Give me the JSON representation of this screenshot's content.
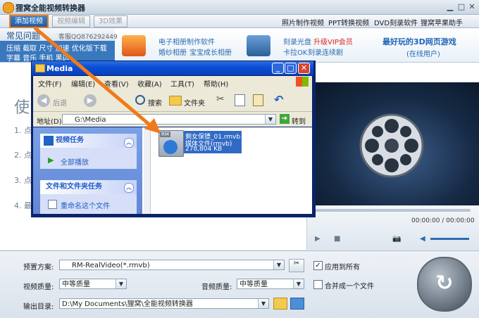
{
  "app": {
    "title": "狸窝全能视频转换器"
  },
  "toolbar": {
    "add_video": "添加视频",
    "video_edit": "视频编辑",
    "effect_3d": "3D效果",
    "links": [
      "照片制作视频",
      "PPT转换视频",
      "DVD刻录软件",
      "狸窝苹果助手"
    ]
  },
  "faq": {
    "title": "常见问题",
    "qq": "客服QQ876292449",
    "links_row1": [
      "压缩",
      "截取",
      "尺寸",
      "加速",
      "优化版下载"
    ],
    "links_row2": [
      "字幕",
      "音乐",
      "手机",
      "黑边"
    ]
  },
  "ads": {
    "ad1_line1": "电子相册制作软件",
    "ad1_line2": "婚纱相册",
    "ad1_line3": "宝宝成长相册",
    "ad2_line1": "刻录光盘",
    "ad2_vip": "升级VIP会员",
    "ad2_line2": "卡拉OK",
    "ad2_line3": "刻录连续剧",
    "ad3_line1": "最好玩的3D网页游戏",
    "ad3_line2": "(在线用户)"
  },
  "guide": {
    "heading": "使",
    "steps": [
      "1. 点",
      "2. 点",
      "3. 点",
      "4. 最"
    ]
  },
  "player": {
    "time": "00:00:00 / 00:00:00"
  },
  "explorer": {
    "title": "Media",
    "menu": [
      "文件(F)",
      "编辑(E)",
      "查看(V)",
      "收藏(A)",
      "工具(T)",
      "帮助(H)"
    ],
    "back": "后退",
    "search": "搜索",
    "folders": "文件夹",
    "address_label": "地址(D)",
    "address": "G:\\Media",
    "go": "转到",
    "task_video": "视频任务",
    "play_all": "全部播放",
    "task_files": "文件和文件夹任务",
    "rename": "重命名这个文件",
    "file_name": "剩女保镖_01.rmvb",
    "file_type": "媒体文件(rmvb)",
    "file_size": "278,804 KB",
    "file_badge": "RM"
  },
  "bottom": {
    "preset_label": "预置方案:",
    "preset_value": "RM-RealVideo(*.rmvb)",
    "apply_all": "应用到所有",
    "video_quality_label": "视频质量:",
    "video_quality_value": "中等质量",
    "audio_quality_label": "音频质量:",
    "audio_quality_value": "中等质量",
    "merge": "合并成一个文件",
    "output_label": "输出目录:",
    "output_value": "D:\\My Documents\\狸窝\\全能视频转换器"
  },
  "colors": {
    "accent": "#f07a1a",
    "xp_title": "#0b4fd8",
    "panel_blue": "#3a78bd"
  }
}
